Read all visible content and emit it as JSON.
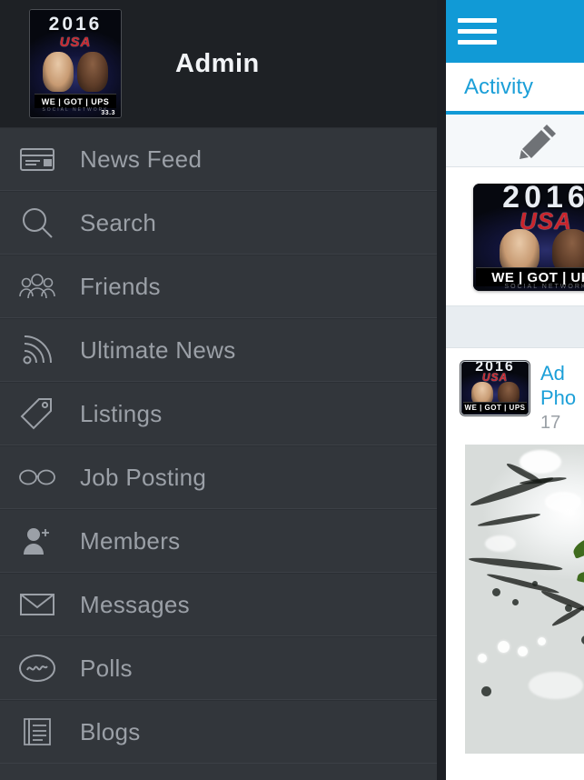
{
  "drawer": {
    "title": "Admin",
    "logo": {
      "year": "2016",
      "country": "USA",
      "wordmark": "WE | GOT | UPS",
      "tagline": "SOCIAL NETWORK",
      "badge": "33.3"
    },
    "menu": [
      {
        "label": "News Feed",
        "icon": "news-feed-icon"
      },
      {
        "label": "Search",
        "icon": "search-icon"
      },
      {
        "label": "Friends",
        "icon": "friends-icon"
      },
      {
        "label": "Ultimate News",
        "icon": "rss-icon"
      },
      {
        "label": "Listings",
        "icon": "tag-icon"
      },
      {
        "label": "Job Posting",
        "icon": "glasses-icon"
      },
      {
        "label": "Members",
        "icon": "member-add-icon"
      },
      {
        "label": "Messages",
        "icon": "envelope-icon"
      },
      {
        "label": "Polls",
        "icon": "polls-icon"
      },
      {
        "label": "Blogs",
        "icon": "blogs-icon"
      }
    ]
  },
  "content": {
    "menu_button": "hamburger-menu-icon",
    "tab": "Activity",
    "compose_icon": "pencil-icon",
    "post": {
      "title": "Ad\nPho",
      "title_line1": "Ad",
      "title_line2": "Pho",
      "time": "17 "
    }
  },
  "colors": {
    "accent": "#119ad6",
    "link": "#1b9fd8",
    "drawer_bg": "#32363b",
    "drawer_header_bg": "#1e2125",
    "gutter": "#1c1f24",
    "menu_label": "#9ba0a7",
    "band": "#e8edf1"
  }
}
